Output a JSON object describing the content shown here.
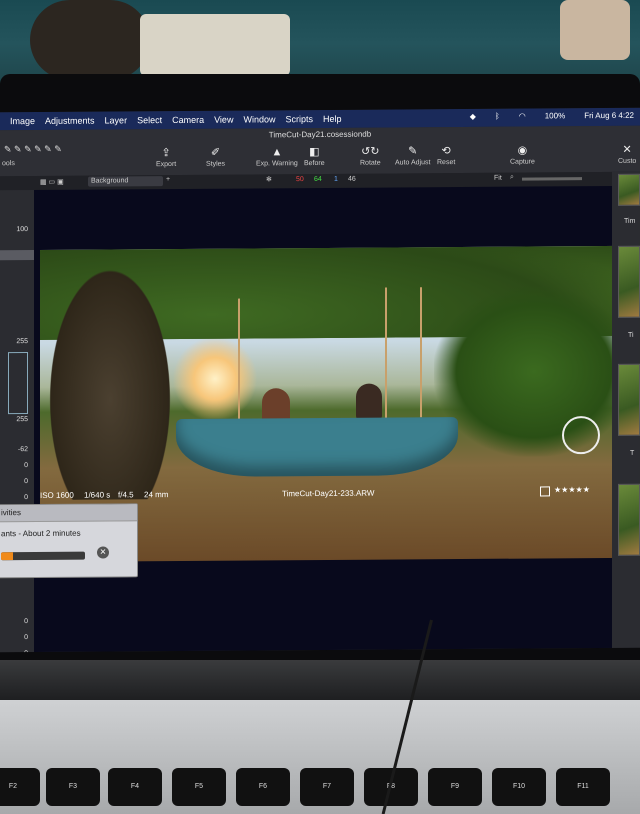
{
  "menubar": {
    "items": [
      "Image",
      "Adjustments",
      "Layer",
      "Select",
      "Camera",
      "View",
      "Window",
      "Scripts",
      "Help"
    ],
    "battery": "100%",
    "datetime": "Fri Aug 6  4:22"
  },
  "toolbar": {
    "document_title": "TimeCut-Day21.cosessiondb",
    "tools_label": "ools",
    "buttons": [
      {
        "icon": "export-icon",
        "label": "Export"
      },
      {
        "icon": "styles-icon",
        "label": "Styles"
      },
      {
        "icon": "warning-icon",
        "label": "Exp. Warning"
      },
      {
        "icon": "before-icon",
        "label": "Before"
      },
      {
        "icon": "rotate-icon",
        "label": "Rotate"
      },
      {
        "icon": "auto-adjust-icon",
        "label": "Auto Adjust"
      },
      {
        "icon": "reset-icon",
        "label": "Reset"
      },
      {
        "icon": "camera-icon",
        "label": "Capture"
      },
      {
        "icon": "custom-icon",
        "label": "Custo"
      }
    ]
  },
  "subbar": {
    "layer_select": "Background",
    "counts": [
      "50",
      "64",
      "1",
      "46"
    ],
    "fit_label": "Fit"
  },
  "left_panel": {
    "values": [
      "100",
      "255",
      "255",
      "-62",
      "0",
      "0",
      "0",
      "0",
      "0",
      "0"
    ]
  },
  "activities": {
    "title": "ivities",
    "task_text": "ants - About 2 minutes",
    "progress": 0.14
  },
  "viewer": {
    "exif": [
      "ISO 1600",
      "1/640 s",
      "f/4.5",
      "24 mm"
    ],
    "filename": "TimeCut-Day21-233.ARW",
    "stars": "★★★★★"
  },
  "right_panel": {
    "thumb_labels": [
      "Tim",
      "Ti",
      "T"
    ]
  },
  "keyboard": {
    "keys": [
      "F2",
      "F3",
      "F4",
      "F5",
      "F6",
      "F7",
      "F8",
      "F9",
      "F10",
      "F11"
    ]
  }
}
